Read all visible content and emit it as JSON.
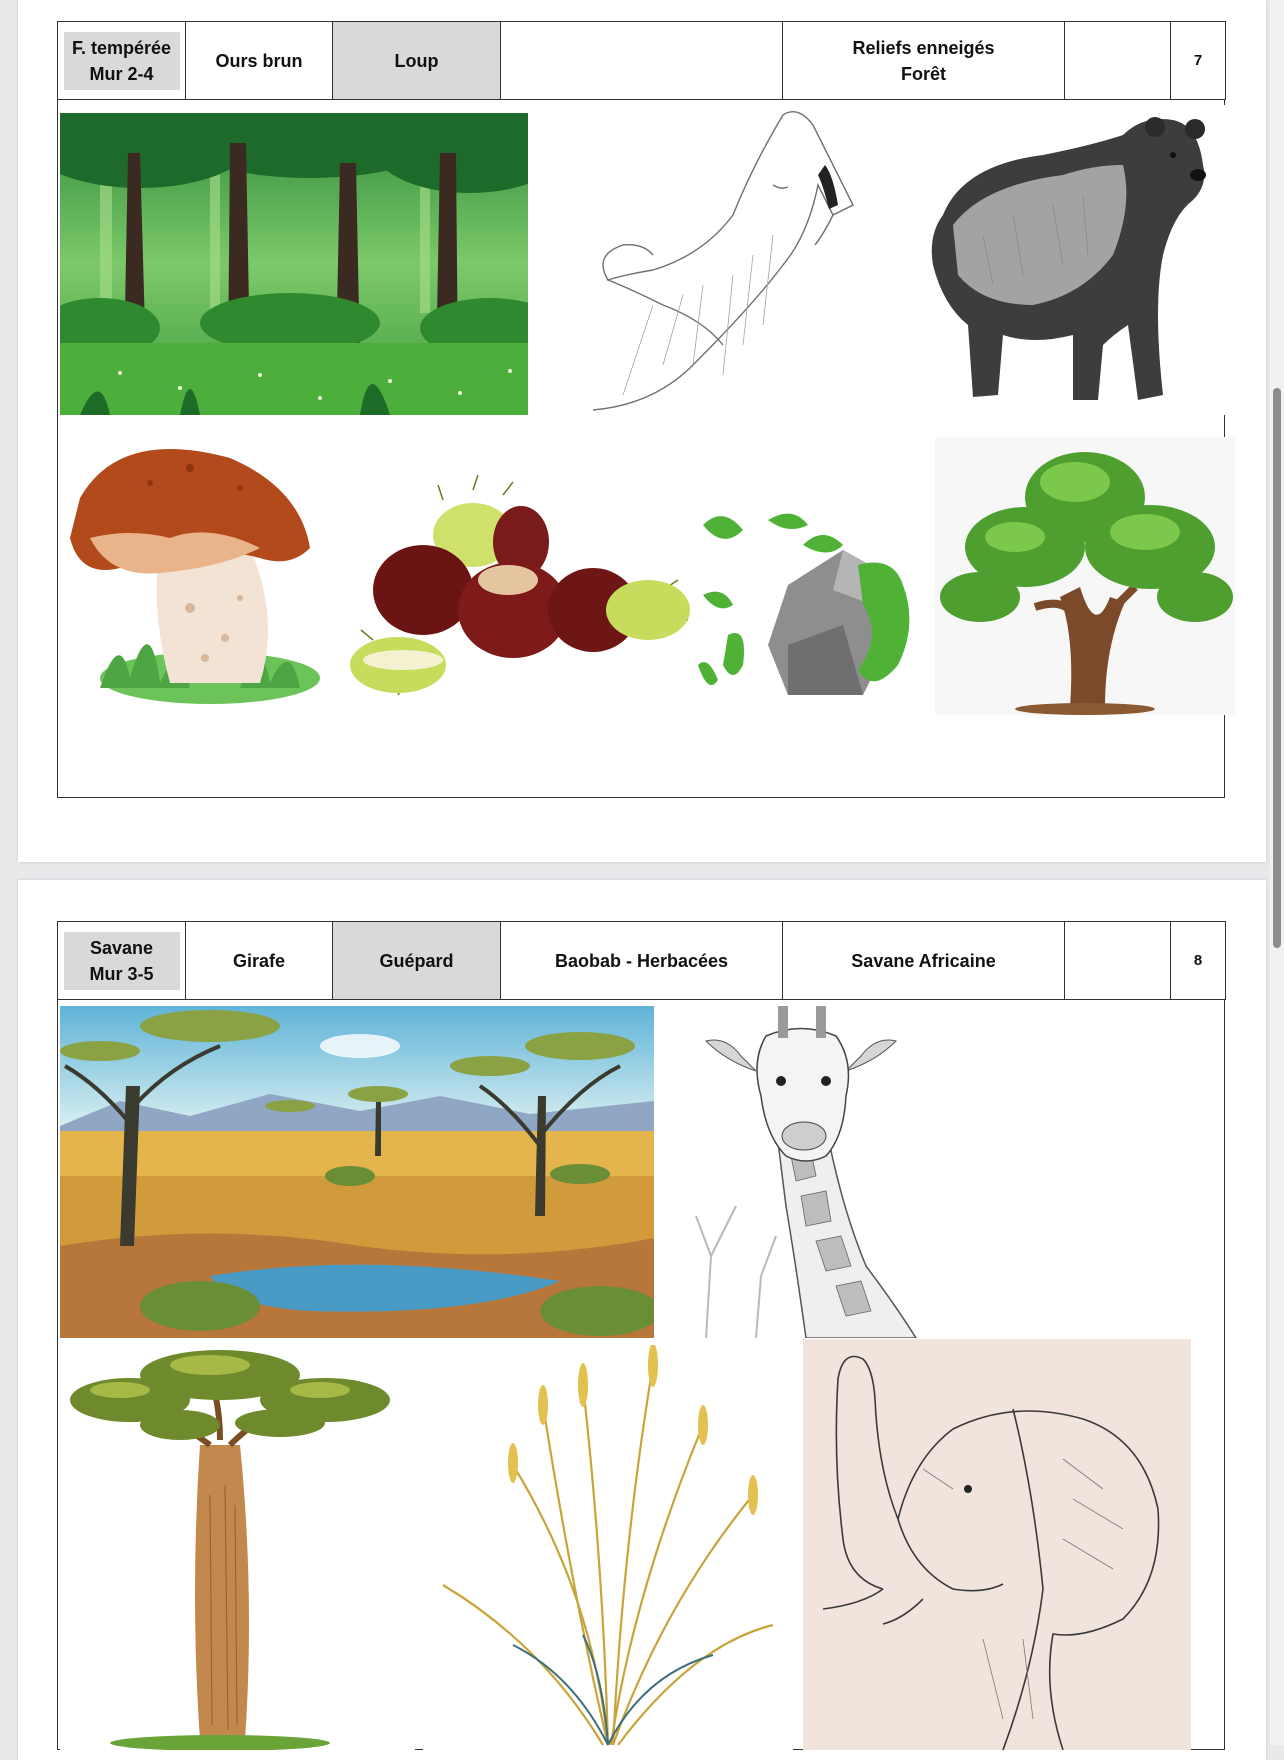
{
  "pages": [
    {
      "header": {
        "biome": "F. tempérée",
        "wall": "Mur 2-4",
        "animal_1": "Ours brun",
        "animal_2": "Loup",
        "plants": "",
        "landscape_line1": "Reliefs enneigés",
        "landscape_line2": "Forêt",
        "extra": "",
        "number": "7"
      },
      "images": [
        "temperate-forest-illustration",
        "howling-wolf-sketch",
        "brown-bear-sketch",
        "mushroom-illustration",
        "chestnuts-illustration",
        "moss-covered-rocks-illustration",
        "oak-tree-illustration"
      ]
    },
    {
      "header": {
        "biome": "Savane",
        "wall": "Mur 3-5",
        "animal_1": "Girafe",
        "animal_2": "Guépard",
        "plants": "Baobab - Herbacées",
        "landscape": "Savane Africaine",
        "extra": "",
        "number": "8"
      },
      "images": [
        "savanna-landscape-illustration",
        "giraffe-sketch",
        "baobab-tree-illustration",
        "dry-grass-illustration",
        "elephant-sketch"
      ]
    }
  ],
  "colors": {
    "header_grey": "#d9d9d9",
    "border": "#333333",
    "page_bg": "#ffffff",
    "canvas_bg": "#e9e9ec"
  }
}
